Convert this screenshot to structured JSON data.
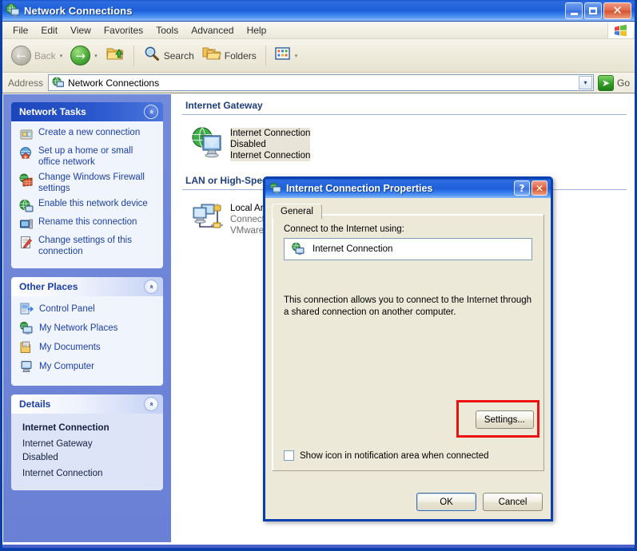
{
  "window": {
    "title": "Network Connections",
    "icon": "network-globe-icon",
    "buttons": {
      "minimize": "–",
      "maximize": "□",
      "close": "✕"
    }
  },
  "menubar": {
    "items": [
      "File",
      "Edit",
      "View",
      "Favorites",
      "Tools",
      "Advanced",
      "Help"
    ],
    "flag_icon": "windows-flag-icon"
  },
  "toolbar": {
    "back_label": "Back",
    "forward_label": "",
    "up_label": "",
    "search_label": "Search",
    "folders_label": "Folders",
    "views_label": "",
    "dropdown_glyph": "▾",
    "back_glyph": "←",
    "forward_glyph": "→"
  },
  "address": {
    "label": "Address",
    "value": "Network Connections",
    "placeholder": "Network Connections",
    "dropdown_glyph": "▾",
    "go_label": "Go",
    "go_glyph": "➔"
  },
  "sidebar": {
    "panels": [
      {
        "title": "Network Tasks",
        "style": "blue",
        "chevron": "«",
        "items": [
          {
            "label": "Create a new connection",
            "icon": "new-connection-icon"
          },
          {
            "label": "Set up a home or small office network",
            "icon": "home-network-icon"
          },
          {
            "label": "Change Windows Firewall settings",
            "icon": "firewall-icon"
          },
          {
            "label": "Enable this network device",
            "icon": "globe-icon"
          },
          {
            "label": "Rename this connection",
            "icon": "rename-icon"
          },
          {
            "label": "Change settings of this connection",
            "icon": "settings-doc-icon"
          }
        ]
      },
      {
        "title": "Other Places",
        "style": "light",
        "chevron": "«",
        "items": [
          {
            "label": "Control Panel",
            "icon": "control-panel-icon"
          },
          {
            "label": "My Network Places",
            "icon": "network-places-icon"
          },
          {
            "label": "My Documents",
            "icon": "documents-icon"
          },
          {
            "label": "My Computer",
            "icon": "computer-icon"
          }
        ]
      }
    ],
    "details": {
      "title": "Details",
      "style": "light",
      "chevron": "«",
      "lines": [
        "Internet Connection",
        "Internet Gateway",
        "Disabled",
        "Internet Connection"
      ]
    }
  },
  "content": {
    "groups": [
      {
        "title": "Internet Gateway",
        "items": [
          {
            "icon": "internet-gateway-icon",
            "lines": [
              "Internet Connection",
              "Disabled",
              "Internet Connection"
            ],
            "selected": true
          }
        ]
      },
      {
        "title": "LAN or High-Speed Internet",
        "items": [
          {
            "icon": "lan-connection-icon",
            "lines": [
              "Local Area Connection",
              "Connected, Firewalled",
              "VMware Accelerated AMD PCNet Ad..."
            ],
            "selected": false
          }
        ]
      }
    ]
  },
  "dialog": {
    "title": "Internet Connection Properties",
    "icon": "network-connection-icon",
    "help_glyph": "?",
    "close_glyph": "✕",
    "tabs": [
      {
        "label": "General",
        "active": true
      }
    ],
    "connect_label": "Connect to the Internet using:",
    "connection_name": "Internet Connection",
    "connection_icon": "globe-connection-icon",
    "description": "This connection allows you to connect to the Internet through a shared connection on another computer.",
    "settings_button": "Settings...",
    "checkbox_label": "Show icon in notification area when connected",
    "checkbox_checked": false,
    "ok_button": "OK",
    "cancel_button": "Cancel",
    "highlight_color": "#ee1111"
  }
}
